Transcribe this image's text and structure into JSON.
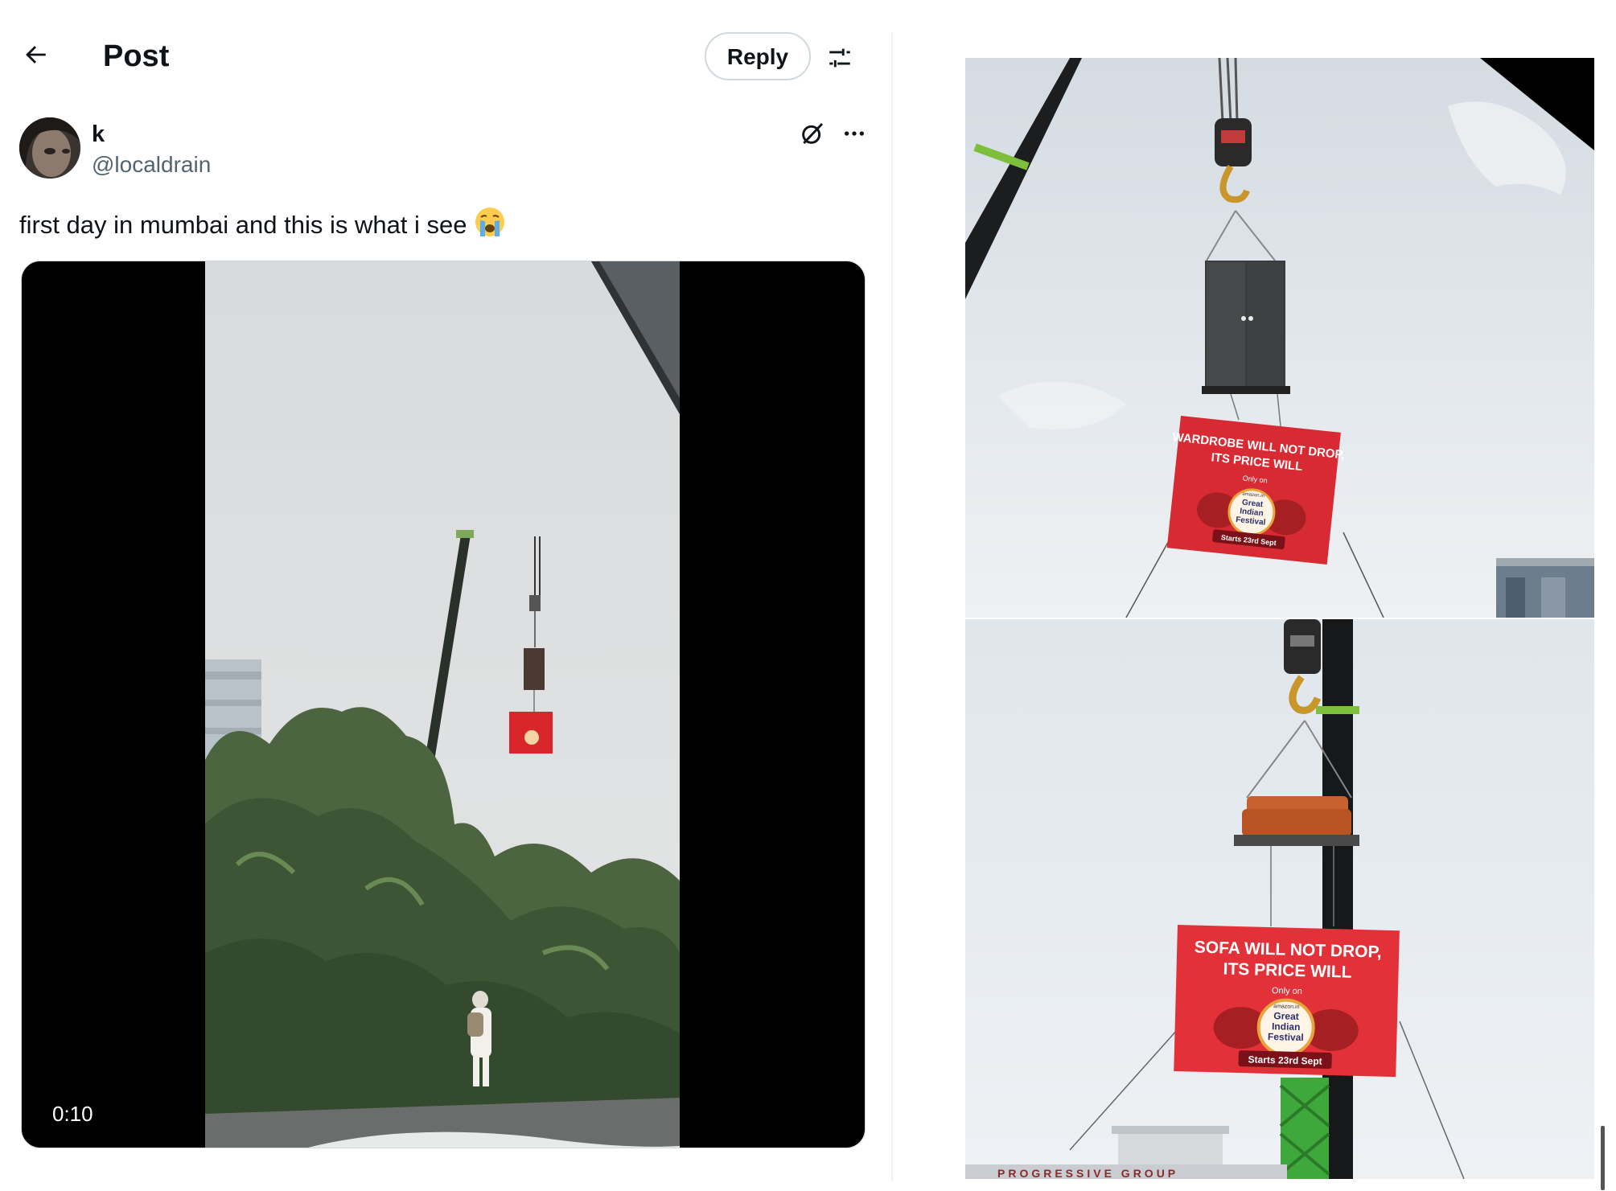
{
  "header": {
    "title": "Post",
    "reply_label": "Reply",
    "back_icon": "arrow-left-icon",
    "settings_icon": "sliders-icon"
  },
  "post": {
    "author_name": "k",
    "author_handle": "@localdrain",
    "text": "first day in mumbai and this is what i see",
    "emoji": "loudly-crying-face",
    "video_duration": "0:10"
  },
  "photos": {
    "top_banner": {
      "line1": "WARDROBE WILL NOT DROP,",
      "line2": "ITS PRICE WILL",
      "only_on": "Only on",
      "brand": "amazon.in",
      "festival_line1": "Great",
      "festival_line2": "Indian",
      "festival_line3": "Festival",
      "starts": "Starts 23rd Sept"
    },
    "bottom_banner": {
      "line1": "SOFA WILL NOT DROP,",
      "line2": "ITS PRICE WILL",
      "only_on": "Only on",
      "brand": "amazon.in",
      "festival_line1": "Great",
      "festival_line2": "Indian",
      "festival_line3": "Festival",
      "starts": "Starts 23rd Sept"
    },
    "building_sign": "PROGRESSIVE GROUP"
  },
  "colors": {
    "banner_red": "#d82a33",
    "crane_green": "#3fa83c",
    "sky": "#e6ebef",
    "text_secondary": "#536471"
  }
}
